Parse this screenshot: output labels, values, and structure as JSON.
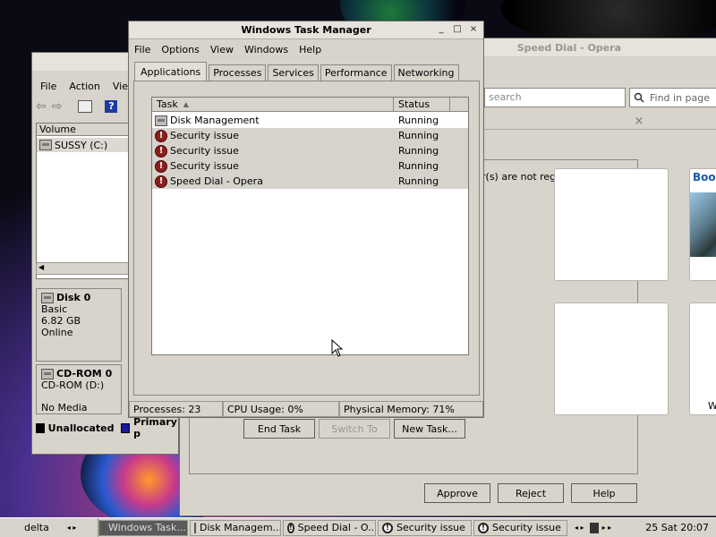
{
  "opera": {
    "title": "Speed Dial - Opera",
    "search_placeholder": "search",
    "find_placeholder": "Find in page",
    "dialog_text": "r(s) are not registered. Accept?",
    "buttons": {
      "approve": "Approve",
      "reject": "Reject",
      "help": "Help"
    },
    "tile_book": "Book",
    "tile_w": "W"
  },
  "diskmgmt": {
    "menu": [
      "File",
      "Action",
      "Vie"
    ],
    "column_volume": "Volume",
    "volume_row": "SUSSY (C:)",
    "disk0": {
      "name": "Disk 0",
      "type": "Basic",
      "size": "6.82 GB",
      "state": "Online"
    },
    "cdrom0": {
      "name": "CD-ROM 0",
      "drive": "CD-ROM (D:)",
      "media": "No Media"
    },
    "legend": {
      "unallocated": "Unallocated",
      "primary": "Primary p"
    }
  },
  "taskmgr": {
    "title": "Windows Task Manager",
    "menu": [
      "File",
      "Options",
      "View",
      "Windows",
      "Help"
    ],
    "tabs": [
      "Applications",
      "Processes",
      "Services",
      "Performance",
      "Networking"
    ],
    "columns": {
      "task": "Task",
      "status": "Status"
    },
    "rows": [
      {
        "task": "Disk Management",
        "status": "Running"
      },
      {
        "task": "Security issue",
        "status": "Running"
      },
      {
        "task": "Security issue",
        "status": "Running"
      },
      {
        "task": "Security issue",
        "status": "Running"
      },
      {
        "task": "Speed Dial - Opera",
        "status": "Running"
      }
    ],
    "buttons": {
      "end_task": "End Task",
      "switch_to": "Switch To",
      "new_task": "New Task..."
    },
    "status": {
      "processes": "Processes: 23",
      "cpu": "CPU Usage: 0%",
      "memory": "Physical Memory: 71%"
    }
  },
  "taskbar": {
    "workspace": "delta",
    "tasks": [
      "Windows Task...",
      "Disk Managem...",
      "Speed Dial - O...",
      "Security issue",
      "Security issue"
    ],
    "clock": "25 Sat 20:07"
  }
}
